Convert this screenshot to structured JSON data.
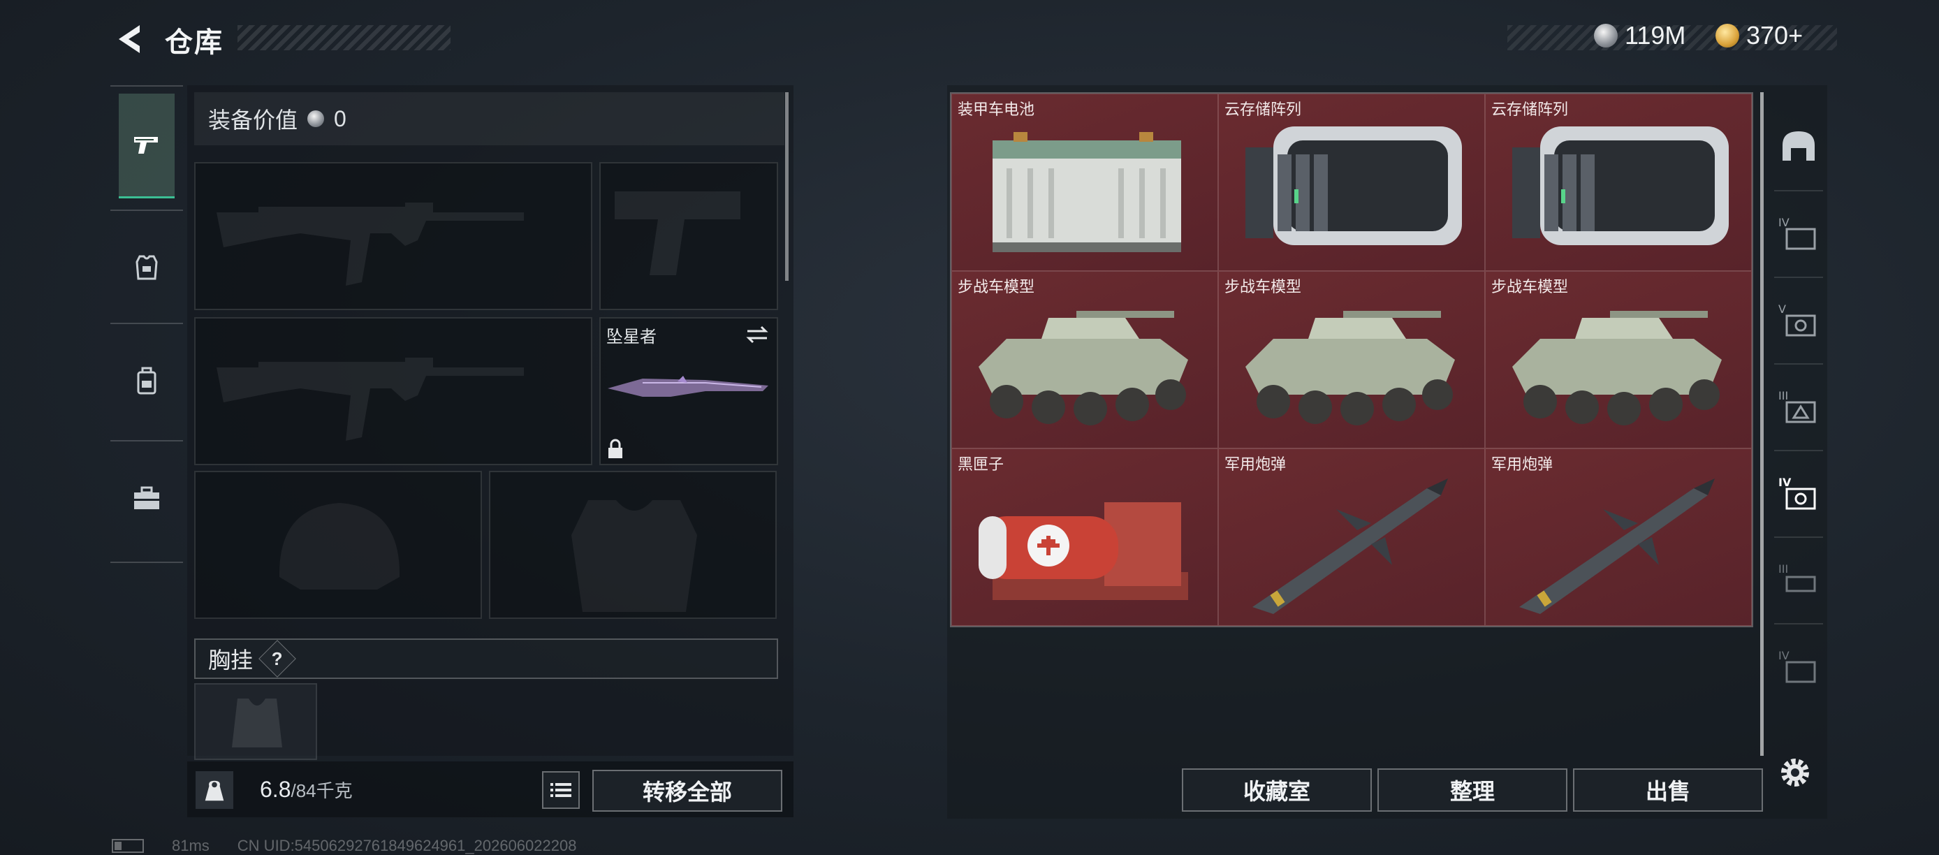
{
  "header": {
    "title": "仓库",
    "currencies": [
      {
        "icon": "silver-coin-icon",
        "value": "119M"
      },
      {
        "icon": "gold-coin-icon",
        "value": "370+"
      }
    ]
  },
  "left_rail": {
    "tabs": [
      {
        "icon": "pistol-icon",
        "active": true
      },
      {
        "icon": "armor-icon",
        "active": false
      },
      {
        "icon": "backpack-icon",
        "active": false
      },
      {
        "icon": "briefcase-icon",
        "active": false
      }
    ]
  },
  "loadout": {
    "value_label": "装备价值",
    "value": "0",
    "melee": {
      "name": "坠星者"
    },
    "chest_rig_label": "胸挂",
    "help_symbol": "?"
  },
  "weight": {
    "current": "6.8",
    "max": "/84千克"
  },
  "buttons": {
    "transfer_all": "转移全部",
    "collection": "收藏室",
    "sort": "整理",
    "sell": "出售"
  },
  "items": [
    {
      "name": "装甲车电池",
      "icon": "armored-vehicle-battery-icon"
    },
    {
      "name": "云存储阵列",
      "icon": "cloud-storage-array-icon"
    },
    {
      "name": "云存储阵列",
      "icon": "cloud-storage-array-icon"
    },
    {
      "name": "步战车模型",
      "icon": "ifv-model-icon"
    },
    {
      "name": "步战车模型",
      "icon": "ifv-model-icon"
    },
    {
      "name": "步战车模型",
      "icon": "ifv-model-icon"
    },
    {
      "name": "黑匣子",
      "icon": "black-box-icon"
    },
    {
      "name": "军用炮弹",
      "icon": "military-shell-icon"
    },
    {
      "name": "军用炮弹",
      "icon": "military-shell-icon"
    }
  ],
  "tier_rail": [
    {
      "icon": "dome-icon"
    },
    {
      "icon": "tier-4-case-icon"
    },
    {
      "icon": "tier-5-case-icon"
    },
    {
      "icon": "tier-3-case-icon"
    },
    {
      "icon": "tier-4-selected-case-icon"
    },
    {
      "icon": "tier-3-small-case-icon"
    },
    {
      "icon": "tier-4-small-case-icon"
    }
  ],
  "status": {
    "ping": "81ms",
    "uid": "CN UID:5450629276184962496​1_202606022208"
  },
  "colors": {
    "item_bg": "#5f262c",
    "active_tab_accent": "#3bbf94"
  }
}
